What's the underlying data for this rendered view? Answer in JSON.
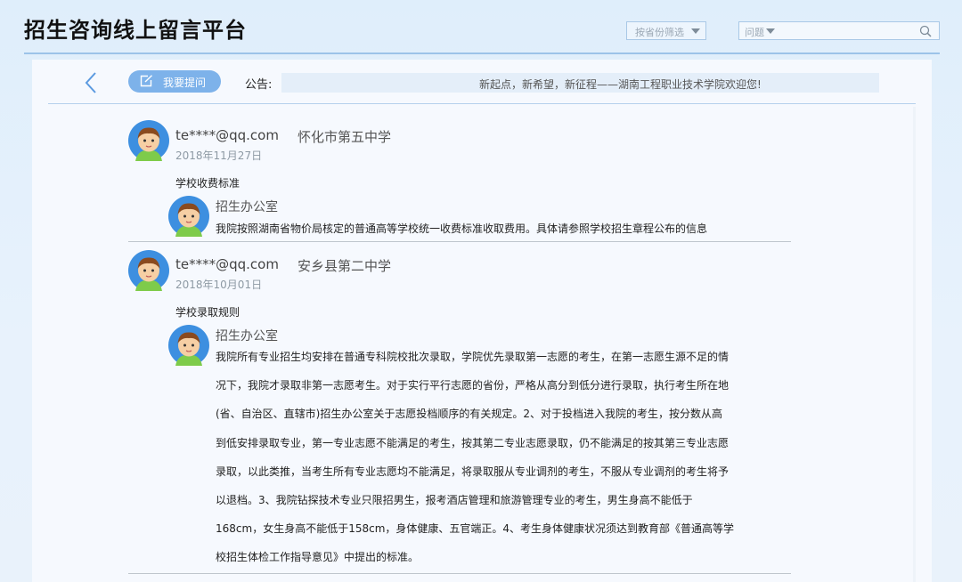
{
  "header": {
    "title": "招生咨询线上留言平台",
    "province_filter": "按省份筛选",
    "question_filter": "问题"
  },
  "toolbar": {
    "ask_label": "我要提问",
    "notice_label": "公告:",
    "notice_text": "新起点，新希望，新征程——湖南工程职业技术学院欢迎您!"
  },
  "posts": [
    {
      "user": "te****@qq.com",
      "school": "怀化市第五中学",
      "date": "2018年11月27日",
      "question": "学校收费标准",
      "reply": {
        "from": "招生办公室",
        "lines": [
          "我院按照湖南省物价局核定的普通高等学校统一收费标准收取费用。具体请参照学校招生章程公布的信息"
        ]
      }
    },
    {
      "user": "te****@qq.com",
      "school": "安乡县第二中学",
      "date": "2018年10月01日",
      "question": "学校录取规则",
      "reply": {
        "from": "招生办公室",
        "lines": [
          "我院所有专业招生均安排在普通专科院校批次录取，学院优先录取第一志愿的考生，在第一志愿生源不足的情",
          "况下，我院才录取非第一志愿考生。对于实行平行志愿的省份，严格从高分到低分进行录取，执行考生所在地",
          "(省、自治区、直辖市)招生办公室关于志愿投档顺序的有关规定。2、对于投档进入我院的考生，按分数从高",
          "到低安排录取专业，第一专业志愿不能满足的考生，按其第二专业志愿录取，仍不能满足的按其第三专业志愿",
          "录取，以此类推，当考生所有专业志愿均不能满足，将录取服从专业调剂的考生，不服从专业调剂的考生将予",
          "以退档。3、我院钻探技术专业只限招男生，报考酒店管理和旅游管理专业的考生，男生身高不能低于",
          "168cm，女生身高不能低于158cm，身体健康、五官端正。4、考生身体健康状况须达到教育部《普通高等学",
          "校招生体检工作指导意见》中提出的标准。"
        ]
      }
    }
  ]
}
